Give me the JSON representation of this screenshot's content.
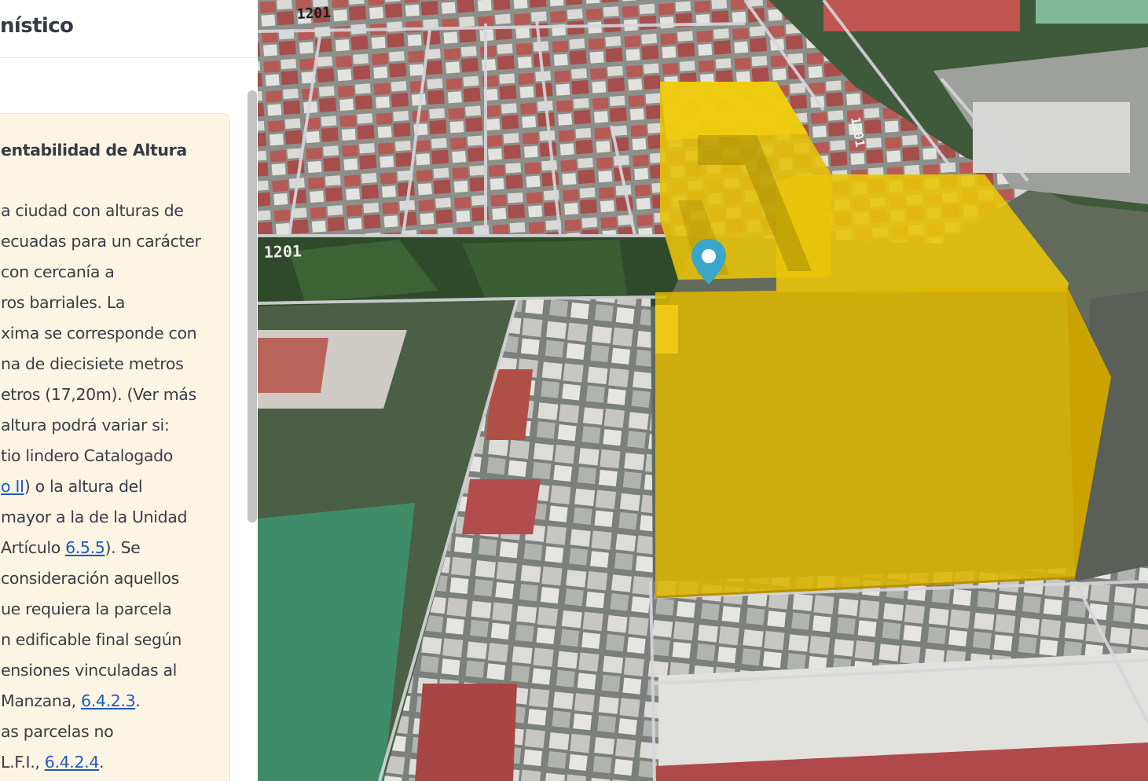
{
  "panel": {
    "title": "nístico",
    "card": {
      "title": "entabilidad de Altura",
      "lines": [
        [
          "a ciudad con alturas de"
        ],
        [
          "ecuadas para un carácter"
        ],
        [
          " con cercanía a"
        ],
        [
          "ros barriales. La"
        ],
        [
          "xima se corresponde con"
        ],
        [
          "na de diecisiete metros"
        ],
        [
          "etros (17,20m). (Ver más"
        ],
        [
          "altura podrá variar si:"
        ],
        [
          "tio lindero Catalogado"
        ],
        [
          {
            "link": "o II"
          },
          ") o la altura del"
        ],
        [
          " mayor a la de la Unidad"
        ],
        [
          "Artículo ",
          {
            "link": "6.5.5"
          },
          "). Se"
        ],
        [
          " consideración aquellos"
        ],
        [
          "ue requiera la parcela"
        ],
        [
          "n edificable final según"
        ],
        [
          "ensiones vinculadas al"
        ],
        [
          "Manzana, ",
          {
            "link": "6.4.2.3"
          },
          "."
        ],
        [
          "as parcelas no"
        ],
        [
          " L.F.I., ",
          {
            "link": "6.4.2.4"
          },
          "."
        ]
      ]
    }
  },
  "map": {
    "street_labels": {
      "top": "1201",
      "middle": "1201",
      "right": "1201"
    },
    "colors": {
      "volume": "#e9c40a",
      "volume_edge": "#c9a200",
      "pin": "#3aa7c9",
      "parcel_lines": "#d6d6dc"
    },
    "icons": [
      "location-pin-icon"
    ]
  }
}
